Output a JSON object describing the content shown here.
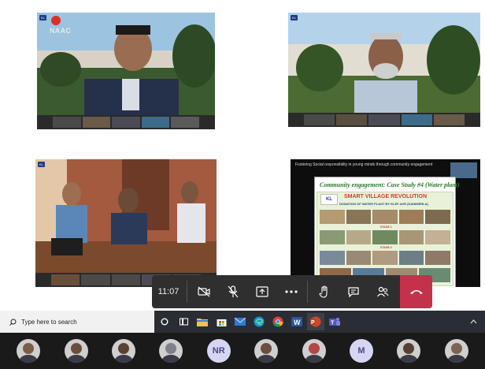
{
  "panels": {
    "top_left": {
      "overlay_text": "NAAC",
      "badge": "KL"
    },
    "top_right": {
      "badge": "KL"
    },
    "bottom_left": {
      "badge": "KL"
    },
    "bottom_right": {
      "caption": "Fostering Social responsibility in young minds through community engagement",
      "slide_title": "Community engagement: Case Study #4 (Water plant)",
      "poster_logo": "KL",
      "poster_headline": "SMART VILLAGE REVOLUTION",
      "poster_subtitle": "DONATION OF WATER PLANT BY KLEF-AVR (KANIMERLA)",
      "stage1": "STAGE 1",
      "stage2": "STAGE 2"
    }
  },
  "meeting_controls": {
    "timer": "11:07",
    "icons": [
      "camera-off-icon",
      "mic-off-icon",
      "share-screen-icon",
      "more-icon",
      "raise-hand-icon",
      "chat-icon",
      "participants-icon",
      "hang-up-icon"
    ]
  },
  "taskbar": {
    "search_placeholder": "Type here to search"
  },
  "attendees": [
    {
      "type": "photo",
      "color": "#7a5c48"
    },
    {
      "type": "photo",
      "color": "#6a4e3c"
    },
    {
      "type": "photo",
      "color": "#5a4232"
    },
    {
      "type": "photo",
      "color": "#80808a"
    },
    {
      "type": "initials",
      "initials": "NR"
    },
    {
      "type": "photo",
      "color": "#6d4f3f"
    },
    {
      "type": "photo",
      "color": "#b44646"
    },
    {
      "type": "initials",
      "initials": "M"
    },
    {
      "type": "photo",
      "color": "#5a3e30"
    },
    {
      "type": "photo",
      "color": "#7b6452"
    }
  ],
  "colors": {
    "hangup": "#c4314b",
    "taskbar": "#2a2d33",
    "initials_bg": "#d6d6f2"
  }
}
